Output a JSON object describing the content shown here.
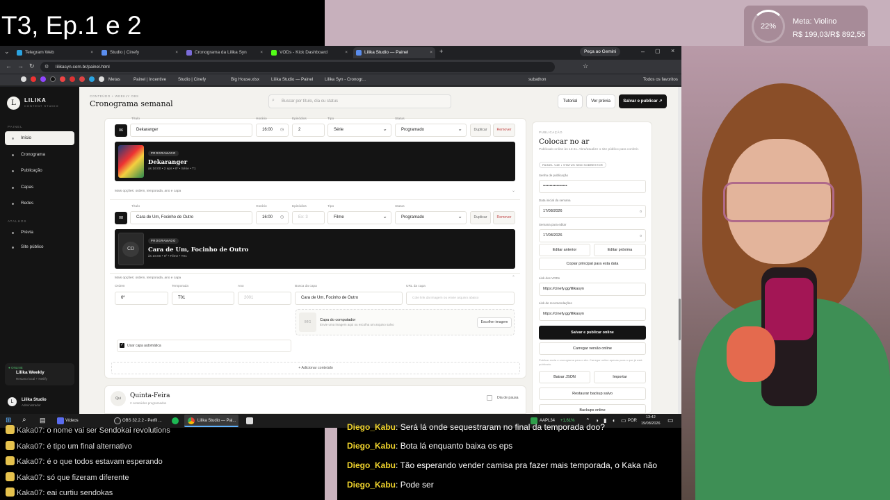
{
  "overlay": {
    "title": "T3, Ep.1 e 2",
    "goal_percent": "22%",
    "goal_name": "Meta: Violino",
    "goal_amount": "R$ 199,03/R$ 892,55",
    "goal_progress": 0.22
  },
  "browser": {
    "tabs": [
      {
        "label": "Telegram Web",
        "color": "#2aa3e0"
      },
      {
        "label": "Studio | Cinefy",
        "color": "#5a8dee"
      },
      {
        "label": "Cronograma da Lilika Syn",
        "color": "#7b6cd9"
      },
      {
        "label": "VODs - Kick Dashboard",
        "color": "#53fc18"
      },
      {
        "label": "Lilika Studio — Painel",
        "color": "#5a8dee"
      }
    ],
    "new_tab": "+",
    "gemini": "Peça ao Gemini",
    "url": "lilikasyn.com.br/painel.html",
    "bookmarks": [
      "Metas",
      "Painel | Incentive",
      "Studio | Cinefy",
      "Big House.xlsx",
      "Lilika Studio — Painel",
      "Lilika Syn - Cronogr...",
      "subathon",
      "Todos os favoritos"
    ]
  },
  "sidebar": {
    "logo_letter": "L",
    "brand": "LILIKA",
    "brand_sub": "CONTENT STUDIO",
    "section_panel": "PAINEL",
    "items": [
      "Início",
      "Cronograma",
      "Publicação",
      "Capas",
      "Redes"
    ],
    "section_preview": "ATALHOS",
    "items2": [
      "Prévia",
      "Site público"
    ],
    "weekly_kicker": "● ONLINE",
    "weekly_title": "Lilika Weekly",
    "weekly_sub": "Resumo local + Netlify",
    "user_initial": "L",
    "user_name": "Lilika Studio",
    "user_role": "Administrador"
  },
  "header": {
    "crumb": "CONTEÚDO + WEEKLY OBS",
    "title": "Cronograma semanal",
    "search_placeholder": "Buscar por título, dia ou status",
    "btn_tutorial": "Tutorial",
    "btn_preview": "Ver prévia",
    "btn_save": "Salvar e publicar ↗"
  },
  "entries": [
    {
      "num": "06",
      "labels": {
        "title": "Título",
        "time": "Horário",
        "eps": "Episódios",
        "type": "Tipo",
        "status": "Status"
      },
      "title": "Dekaranger",
      "time": "16:00",
      "eps": "2",
      "type": "Série",
      "status": "Programado",
      "dup": "Duplicar",
      "remove": "Remover",
      "badge": "PROGRAMADO",
      "banner_title": "Dekaranger",
      "banner_meta": "às 16:00 • 2 eps • 6º • Série • T1",
      "more": "Mais opções: ordem, temporada, ano e capa"
    },
    {
      "num": "08",
      "labels": {
        "title": "Título",
        "time": "Horário",
        "eps": "Episódios",
        "type": "Tipo",
        "status": "Status"
      },
      "title": "Cara de Um, Focinho de Outro",
      "time": "16:00",
      "eps_placeholder": "Ex: 3",
      "type": "Filme",
      "status": "Programado",
      "dup": "Duplicar",
      "remove": "Remover",
      "badge": "PROGRAMADO",
      "thumb": "CD",
      "banner_title": "Cara de Um, Focinho de Outro",
      "banner_meta": "às 16:00 • 6º • Filme • T01",
      "more": "Mais opções: ordem, temporada, ano e capa",
      "extra_labels": {
        "order": "Ordem",
        "season": "Temporada",
        "year": "Ano",
        "search": "Busca da capa",
        "url": "URL da capa"
      },
      "order": "6º",
      "season": "T01",
      "year_placeholder": "2001",
      "search": "Cara de Um, Focinho de Outro",
      "url_placeholder": "Cole link da imagem ou envie arquivo abaixo",
      "upload_img": "IMG",
      "upload_title": "Capa do computador",
      "upload_sub": "Envie uma imagem aqui ou escolha um arquivo salvo",
      "upload_btn": "Escolher imagem",
      "auto_cover": "Usar capa automática"
    }
  ],
  "add_content": "+ Adicionar conteúdo",
  "next_day": {
    "abbr": "Qui",
    "title": "Quinta-Feira",
    "sub": "2 conteúdos programados",
    "rest": "Dia de pausa"
  },
  "publish": {
    "kicker": "PUBLICAÇÃO",
    "title": "Colocar no ar",
    "desc": "Publicado online às 13:41. Abra/atualize o site público para conferir.",
    "badge": "PAINEL V4E • STATUS SEM SOBRESTOR",
    "pw_label": "Senha de publicação",
    "pw_value": "••••••••••••••••••",
    "start_label": "Data inicial da semana",
    "start_value": "17/08/2026",
    "edit_label": "Semana para editar",
    "edit_value": "17/08/2026",
    "prev": "Editar anterior",
    "next": "Editar próxima",
    "copy": "Copiar principal para esta data",
    "vods_label": "Link dos VODs",
    "vods_value": "https://cinefy.gg/lilikasyn",
    "rec_label": "Link de recomendações",
    "rec_value": "https://cinefy.gg/lilikasyn",
    "save_pub": "Salvar e publicar online",
    "load": "Carregar versão online",
    "note": "Publicar envia o cronograma para o site. Carregar online apenas puxa o que já está publicado.",
    "json": "Baixar JSON",
    "import": "Importar",
    "restore": "Restaurar backup salvo",
    "backups": "Backups online"
  },
  "taskbar": {
    "videos": "Vídeos",
    "obs": "OBS 32.2.2 - Perfil ...",
    "chrome": "Lilika Studio — Pai...",
    "stock": "AAPL34",
    "stock_change": "+1,61%",
    "lang": "POR",
    "time": "13:42",
    "date": "19/08/2026"
  },
  "chat_left": [
    {
      "user": "Kaka07",
      "msg": "o nome vai ser Sendokai revolutions"
    },
    {
      "user": "Kaka07",
      "msg": "é tipo um final alternativo"
    },
    {
      "user": "Kaka07",
      "msg": "é o que todos estavam esperando"
    },
    {
      "user": "Kaka07",
      "msg": "só que fizeram diferente"
    },
    {
      "user": "Kaka07",
      "msg": "eai curtiu sendokas"
    }
  ],
  "chat_right": [
    {
      "user": "Diego_Kabu",
      "msg": "Será lá onde sequestraram no final da temporada doo?"
    },
    {
      "user": "Diego_Kabu",
      "msg": "Bota lá enquanto baixa os eps"
    },
    {
      "user": "Diego_Kabu",
      "msg": "Tão esperando vender camisa pra fazer mais temporada, o Kaka não"
    },
    {
      "user": "Diego_Kabu",
      "msg": "Pode ser"
    }
  ]
}
